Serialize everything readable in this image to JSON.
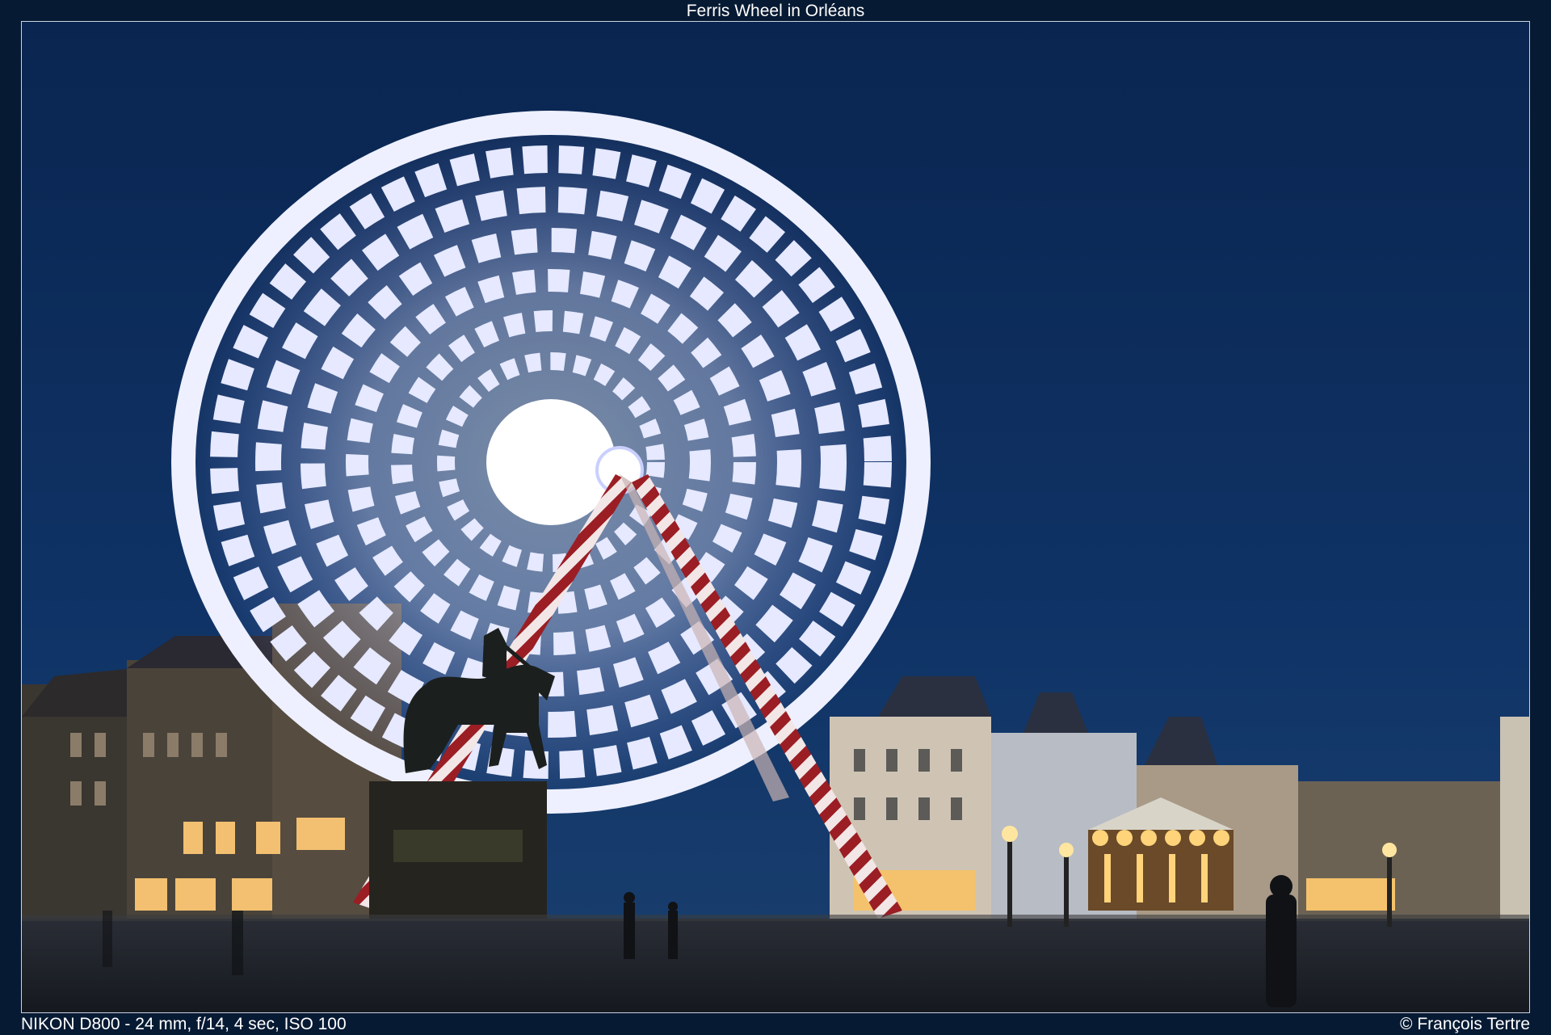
{
  "title": "Ferris Wheel in Orléans",
  "caption": {
    "camera": "NIKON D800 - 24 mm, f/14, 4 sec, ISO 100",
    "copyright": "© François Tertre"
  },
  "scene": {
    "subject": "ferris-wheel-long-exposure",
    "colors": {
      "sky_top": "#0c2a57",
      "sky_bottom": "#123a6e",
      "wheel_light": "#eef0ff",
      "wheel_gap": "#3a4f80",
      "support_red": "#9a1e24",
      "ground": "#1d2431",
      "warm_light": "#ffcf6a"
    }
  }
}
